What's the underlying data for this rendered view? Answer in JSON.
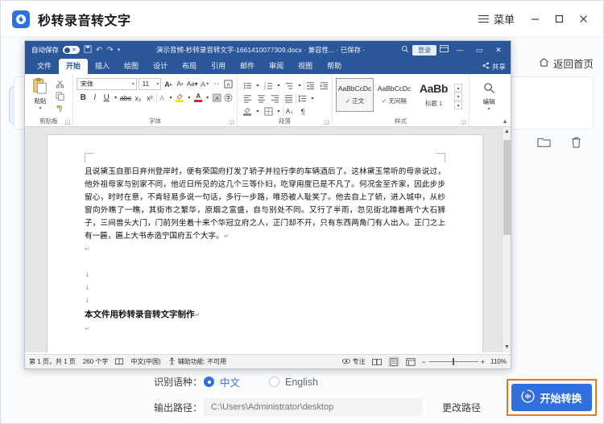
{
  "app": {
    "title": "秒转录音转文字",
    "logo_icon": "app-logo-icon",
    "menu_label": "菜单",
    "menu_icon": "hamburger-icon",
    "minimize_icon": "minimize-icon",
    "maximize_icon": "maximize-icon",
    "close_icon": "close-icon",
    "home_link": "返回首页",
    "home_icon": "home-icon",
    "folder_icon": "folder-icon",
    "delete_icon": "trash-icon",
    "accent_color": "#2f6fe0",
    "highlight_color": "#e8771d"
  },
  "word": {
    "titlebar": {
      "autosave_label": "自动保存",
      "autosave_state": "off",
      "save_icon": "save-icon",
      "undo_icon": "undo-icon",
      "redo_icon": "redo-icon",
      "customize_icon": "chevron-down-icon",
      "document_title": "演示音频-秒转录音转文字-1661410077309.docx  ·  兼容性... · 已保存 ·",
      "search_icon": "search-icon",
      "login_label": "登录",
      "ribbon_display_icon": "ribbon-options-icon",
      "minimize_icon": "minimize-icon",
      "restore_icon": "restore-icon",
      "close_icon": "close-icon"
    },
    "tabs": [
      {
        "label": "文件",
        "active": false
      },
      {
        "label": "开始",
        "active": true
      },
      {
        "label": "插入",
        "active": false
      },
      {
        "label": "绘图",
        "active": false
      },
      {
        "label": "设计",
        "active": false
      },
      {
        "label": "布局",
        "active": false
      },
      {
        "label": "引用",
        "active": false
      },
      {
        "label": "邮件",
        "active": false
      },
      {
        "label": "审阅",
        "active": false
      },
      {
        "label": "视图",
        "active": false
      },
      {
        "label": "帮助",
        "active": false
      }
    ],
    "share_label": "共享",
    "share_icon": "share-icon",
    "ribbon": {
      "clipboard": {
        "group_label": "剪贴板",
        "paste_label": "粘贴",
        "paste_icon": "paste-icon",
        "cut_icon": "scissors-icon",
        "copy_icon": "copy-icon",
        "format_painter_icon": "format-painter-icon"
      },
      "font": {
        "group_label": "字体",
        "font_name": "宋体",
        "font_size": "11",
        "grow_font_icon": "grow-font-icon",
        "shrink_font_icon": "shrink-font-icon",
        "change_case_icon": "change-case-icon",
        "clear_format_icon": "clear-formatting-icon",
        "phonetic_icon": "phonetic-guide-icon",
        "char_border_icon": "character-border-icon",
        "bold_label": "B",
        "italic_label": "I",
        "underline_label": "U",
        "strikethrough_icon": "strikethrough-icon",
        "subscript_label": "x₂",
        "superscript_label": "x²",
        "text_effects_icon": "text-effects-icon",
        "highlight_icon": "highlight-color-icon",
        "font_color_icon": "font-color-icon",
        "char_shading_icon": "character-shading-icon",
        "enclose_char_icon": "enclose-character-icon"
      },
      "paragraph": {
        "group_label": "段落",
        "bullets_icon": "bullets-icon",
        "numbering_icon": "numbering-icon",
        "multilevel_icon": "multilevel-list-icon",
        "decrease_indent_icon": "decrease-indent-icon",
        "increase_indent_icon": "increase-indent-icon",
        "align_left_icon": "align-left-icon",
        "align_center_icon": "align-center-icon",
        "align_right_icon": "align-right-icon",
        "justify_icon": "justify-icon",
        "line_spacing_icon": "line-spacing-icon",
        "shading_icon": "shading-icon",
        "borders_icon": "borders-icon",
        "show_marks_icon": "show-formatting-marks-icon",
        "sort_icon": "sort-icon"
      },
      "styles": {
        "group_label": "样式",
        "items": [
          {
            "preview": "AaBbCcDc",
            "name": "正文",
            "selected": true
          },
          {
            "preview": "AaBbCcDc",
            "name": "无间隔",
            "selected": false
          },
          {
            "preview": "AaBb",
            "name": "标题 1",
            "selected": false
          }
        ]
      },
      "editing": {
        "group_label": "编辑",
        "label": "编辑",
        "icon": "find-icon"
      },
      "collapse_icon": "collapse-ribbon-icon"
    },
    "document": {
      "paragraph": "且说黛玉自那日弃州登岸时，便有荣国府打发了轿子并拉行李的车辆酒后了。这林黛玉常听的母亲说过，他外祖母家与别家不同，他近日所见的这几个三等仆妇，吃穿用度已是不凡了。何况金至齐家，因此步步留心，时时在意，不肯轻易多说一句话，多行一步路，唯恐被人耻笑了。他去自上了轿，进入城中，从纱窗向外瞧了一瞧，其街市之繁华，原烟之富盛，自与别处不同。又行了半雨，忽见街北蹲着两个大石狮子，三间兽头大门，门前列坐着十来个华冠立府之人，正门却不开，只有东西两角门有人出入。正门之上有一匾，匾上大书赤造宁国府五个大字。",
      "footer_line": "本文件用秒转录音转文字制作"
    },
    "status": {
      "page_info": "第 1 页，共 1 页",
      "word_count": "260 个字",
      "proofing_icon": "proofing-icon",
      "language": "中文(中国)",
      "accessibility_icon": "accessibility-icon",
      "accessibility": "辅助功能: 不可用",
      "focus_icon": "focus-icon",
      "focus_label": "专注",
      "view_read_icon": "read-mode-icon",
      "view_print_icon": "print-layout-icon",
      "view_web_icon": "web-layout-icon",
      "zoom_out_icon": "zoom-out-icon",
      "zoom_in_icon": "zoom-in-icon",
      "zoom_level": "110%"
    }
  },
  "controls": {
    "language_label": "识别语种：",
    "options": [
      {
        "label": "中文",
        "selected": true
      },
      {
        "label": "English",
        "selected": false
      }
    ],
    "path_label": "输出路径：",
    "path_placeholder": "C:\\Users\\Administrator\\desktop",
    "path_value": "",
    "change_path_label": "更改路径",
    "convert_label": "开始转换",
    "convert_icon": "audio-wave-icon"
  }
}
